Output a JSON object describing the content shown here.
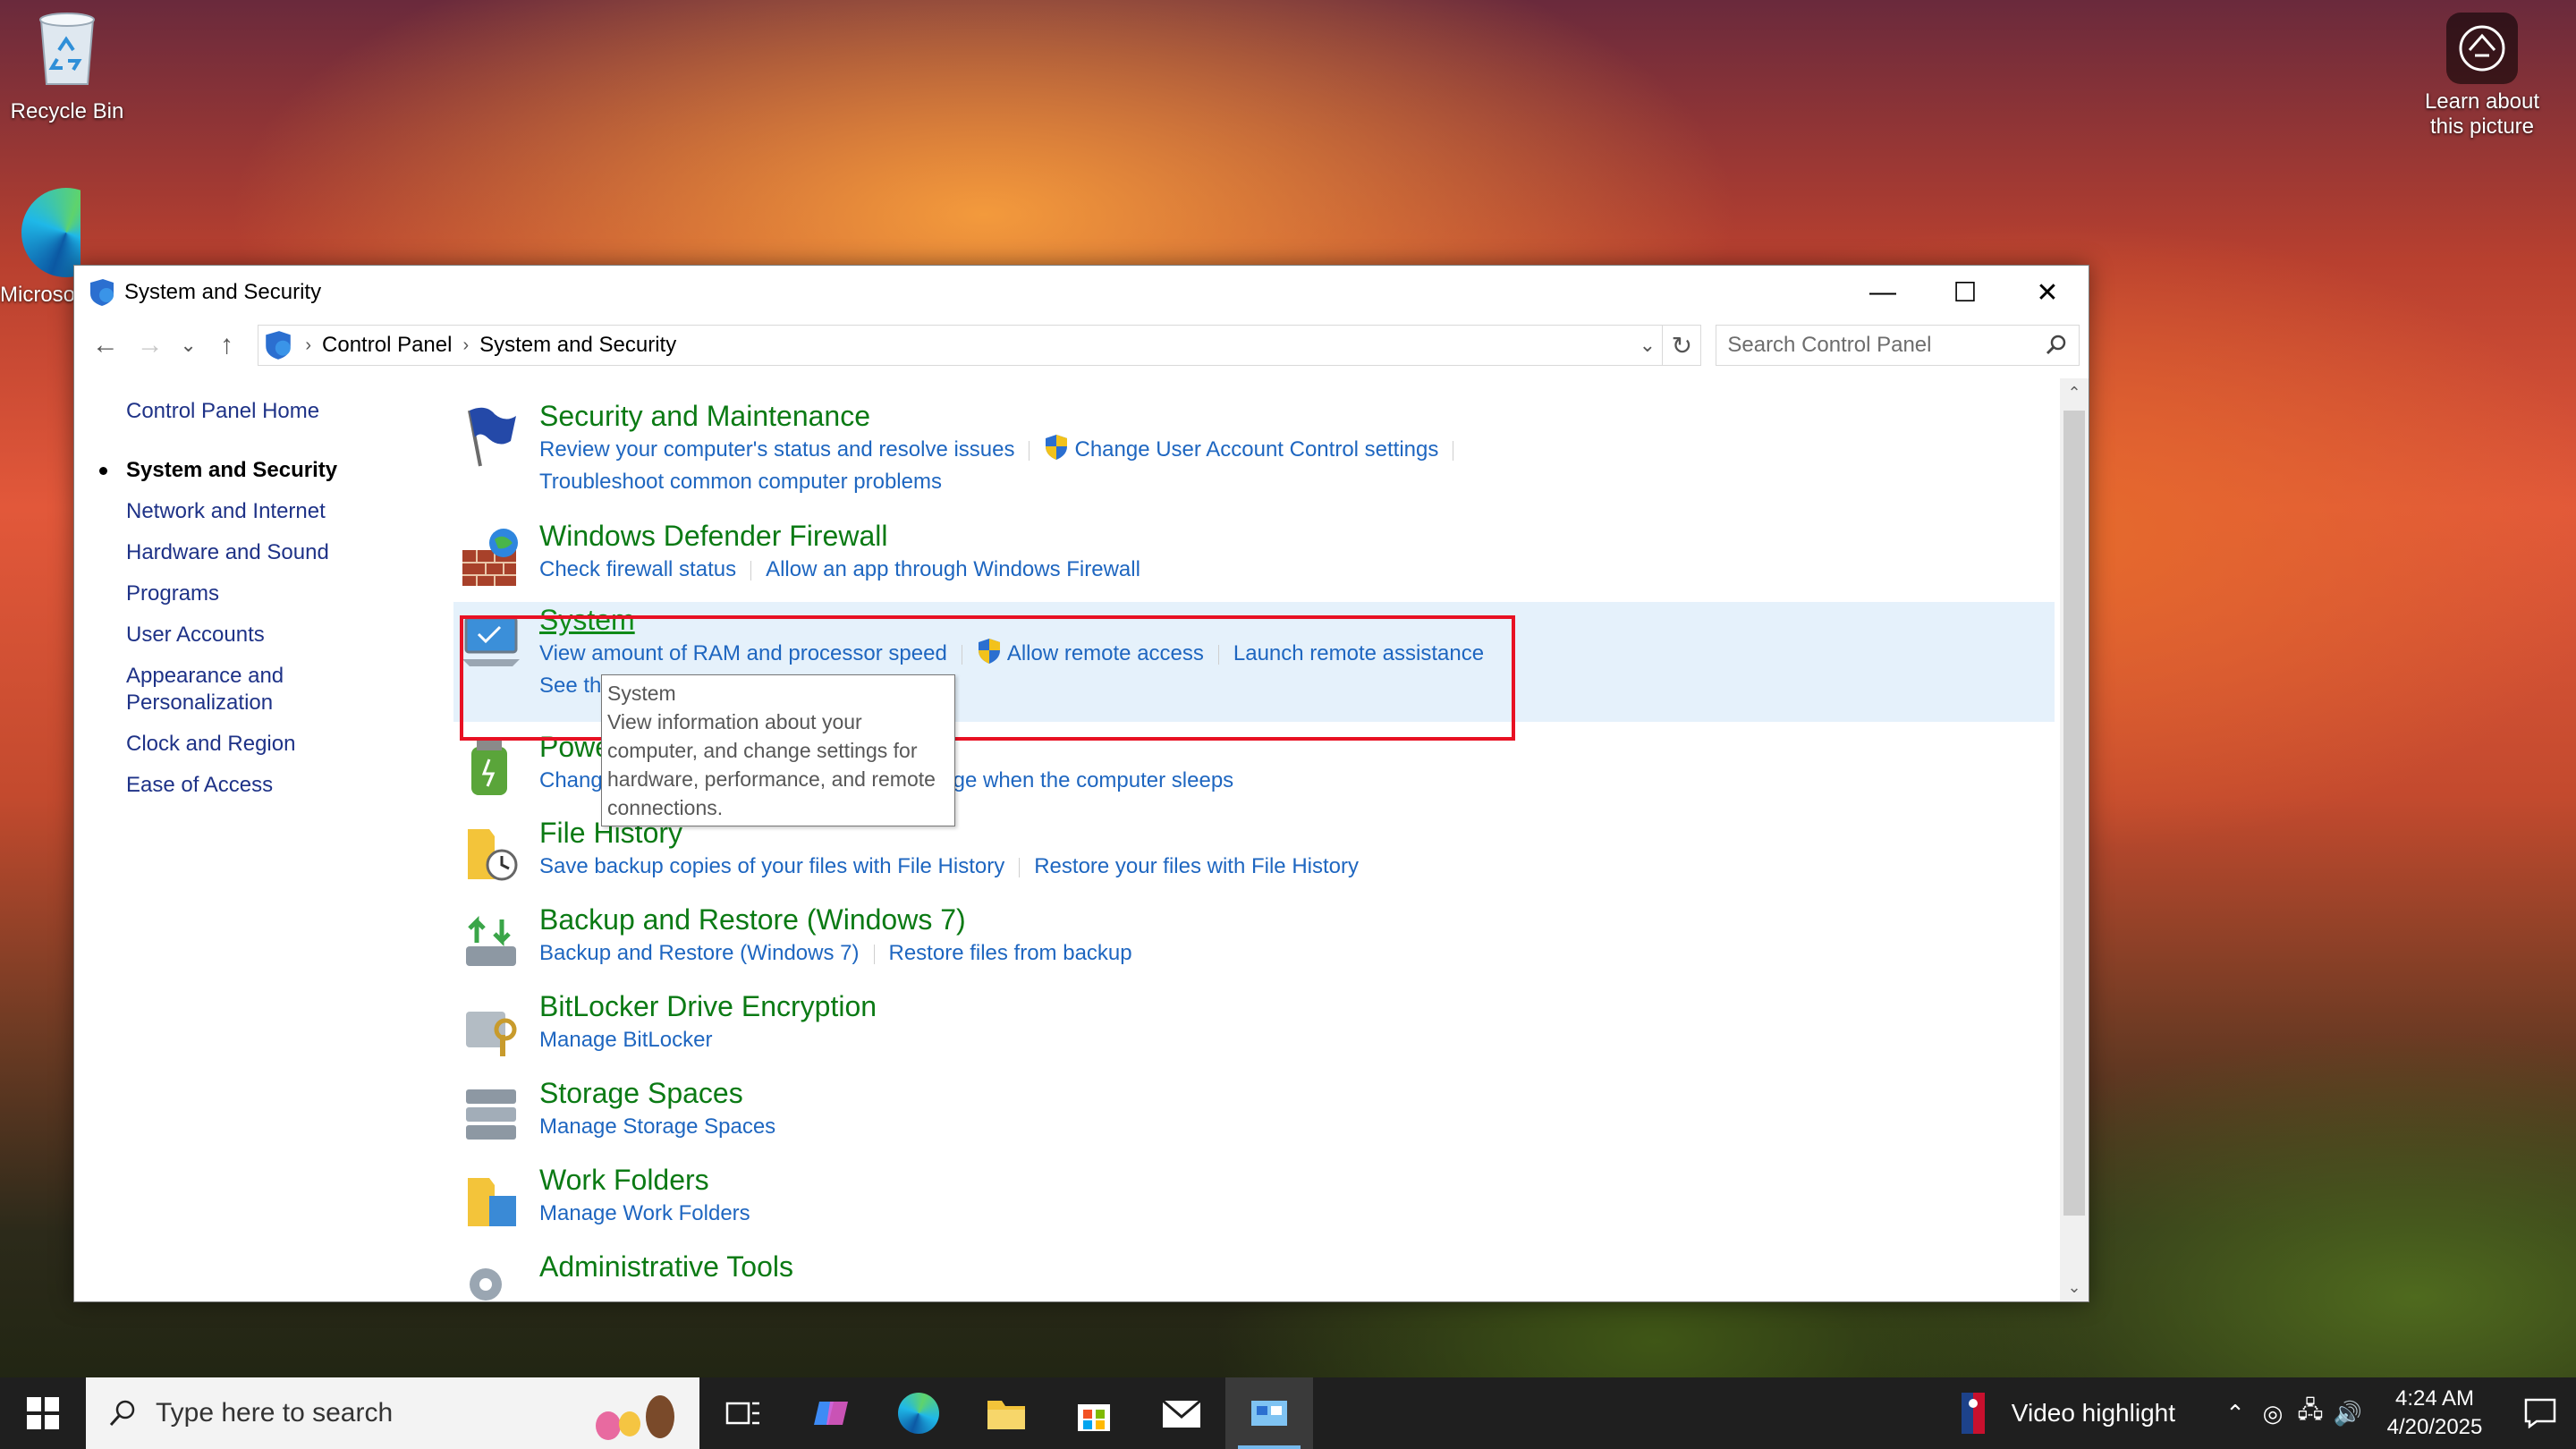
{
  "desktop": {
    "recycle_bin": "Recycle Bin",
    "edge_label": "Microsoft Edge",
    "learn_about": "Learn about this picture"
  },
  "window": {
    "title": "System and Security",
    "controls": {
      "minimize": "—",
      "maximize": "☐",
      "close": "✕"
    }
  },
  "address": {
    "breadcrumbs": [
      "Control Panel",
      "System and Security"
    ],
    "search_placeholder": "Search Control Panel"
  },
  "leftnav": {
    "home": "Control Panel Home",
    "items": [
      "System and Security",
      "Network and Internet",
      "Hardware and Sound",
      "Programs",
      "User Accounts",
      "Appearance and Personalization",
      "Clock and Region",
      "Ease of Access"
    ],
    "active_index": 0
  },
  "categories": [
    {
      "title": "Security and Maintenance",
      "icon": "flag-icon",
      "links": [
        "Review your computer's status and resolve issues",
        "Change User Account Control settings",
        "Troubleshoot common computer problems"
      ]
    },
    {
      "title": "Windows Defender Firewall",
      "icon": "firewall-icon",
      "links": [
        "Check firewall status",
        "Allow an app through Windows Firewall"
      ]
    },
    {
      "title": "System",
      "icon": "system-monitor-icon",
      "links": [
        "View amount of RAM and processor speed",
        "Allow remote access",
        "Launch remote assistance",
        "See the name of this computer"
      ]
    },
    {
      "title": "Power Options",
      "icon": "power-icon",
      "links": [
        "Change what the power buttons do",
        "Change when the computer sleeps"
      ]
    },
    {
      "title": "File History",
      "icon": "file-history-icon",
      "links": [
        "Save backup copies of your files with File History",
        "Restore your files with File History"
      ]
    },
    {
      "title": "Backup and Restore (Windows 7)",
      "icon": "backup-icon",
      "links": [
        "Backup and Restore (Windows 7)",
        "Restore files from backup"
      ]
    },
    {
      "title": "BitLocker Drive Encryption",
      "icon": "bitlocker-icon",
      "links": [
        "Manage BitLocker"
      ]
    },
    {
      "title": "Storage Spaces",
      "icon": "storage-spaces-icon",
      "links": [
        "Manage Storage Spaces"
      ]
    },
    {
      "title": "Work Folders",
      "icon": "work-folders-icon",
      "links": [
        "Manage Work Folders"
      ]
    },
    {
      "title": "Administrative Tools",
      "icon": "admin-tools-icon",
      "links": []
    }
  ],
  "tooltip": {
    "title": "System",
    "body": "View information about your computer, and change settings for hardware, performance, and remote connections."
  },
  "taskbar": {
    "search_placeholder": "Type here to search",
    "news": "Video highlight",
    "time": "4:24 AM",
    "date": "4/20/2025"
  },
  "colors": {
    "link": "#1e66c0",
    "category_title": "#0b7a14",
    "selected_row": "#e5f1fb",
    "highlight_border": "#e81123"
  }
}
